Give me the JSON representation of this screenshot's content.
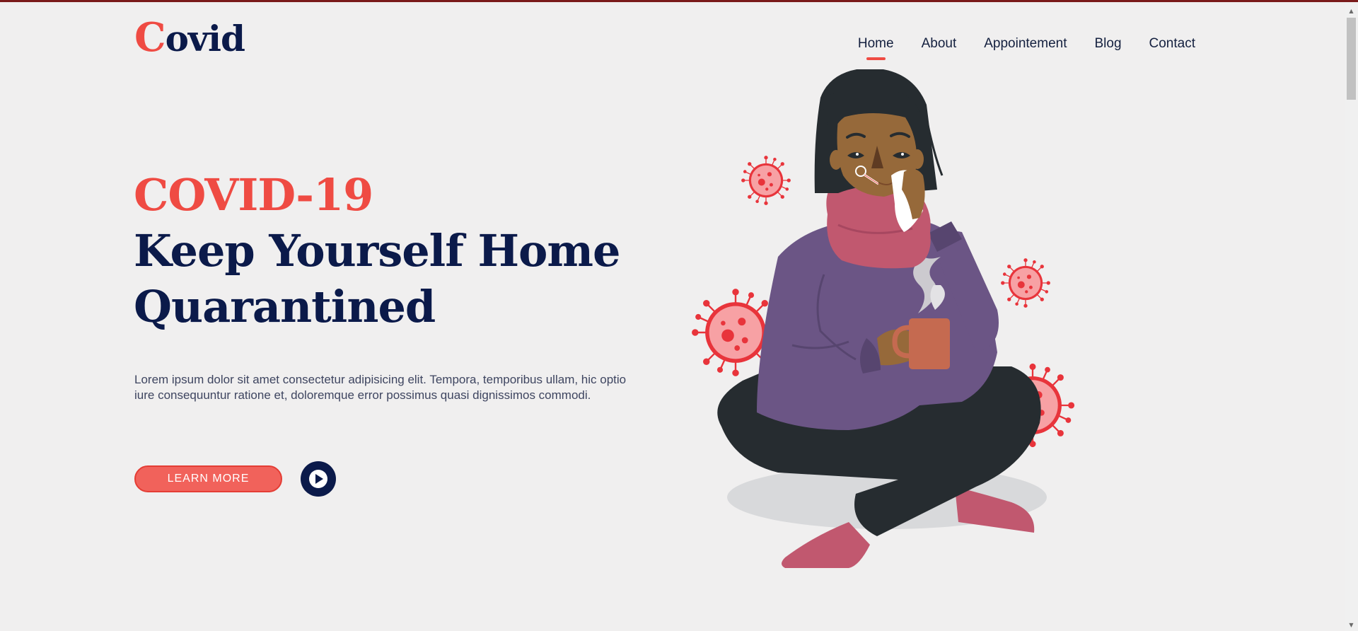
{
  "logo": {
    "first_letter": "C",
    "rest": "ovid"
  },
  "nav": {
    "items": [
      {
        "label": "Home",
        "active": true
      },
      {
        "label": "About"
      },
      {
        "label": "Appointement"
      },
      {
        "label": "Blog"
      },
      {
        "label": "Contact"
      }
    ]
  },
  "hero": {
    "title_red": "COVID-19",
    "title_line1": "Keep Yourself Home",
    "title_line2": "Quarantined",
    "description": "Lorem ipsum dolor sit amet consectetur adipisicing elit. Tempora, temporibus ullam, hic optio iure consequuntur ratione et, doloremque error possimus quasi dignissimos commodi.",
    "learn_more": "LEARN MORE",
    "play_icon": "play-icon"
  },
  "colors": {
    "accent": "#ef4b43",
    "navy": "#0b1a4a",
    "background": "#f0efef"
  }
}
